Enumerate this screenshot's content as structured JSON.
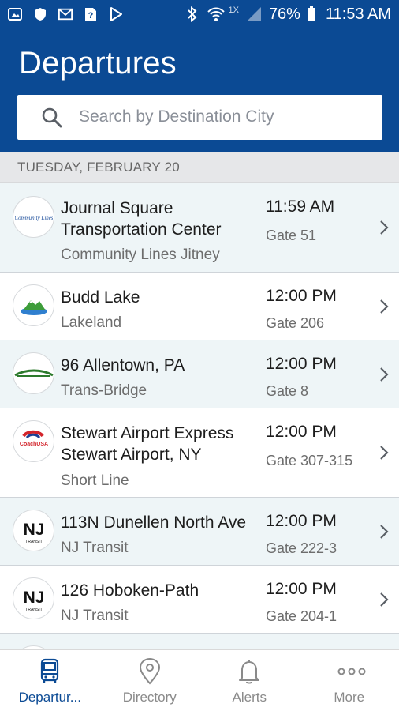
{
  "status_bar": {
    "icons": [
      "image-icon",
      "shield-icon",
      "mail-icon",
      "sim-help-icon",
      "play-store-icon"
    ],
    "right_icons": [
      "bluetooth-icon",
      "wifi-icon",
      "signal-icon",
      "battery-icon"
    ],
    "network_label": "1X",
    "battery": "76%",
    "time": "11:53 AM"
  },
  "header": {
    "title": "Departures",
    "search_placeholder": "Search by Destination City",
    "search_icon": "search-icon"
  },
  "date_label": "TUESDAY, FEBRUARY 20",
  "departures": [
    {
      "destination": "Journal Square Transportation Center",
      "carrier": "Community Lines Jitney",
      "time": "11:59 AM",
      "gate": "Gate 51",
      "logo": "community-lines-logo",
      "logo_text": "Community Lines"
    },
    {
      "destination": "Budd Lake",
      "carrier": "Lakeland",
      "time": "12:00 PM",
      "gate": "Gate 206",
      "logo": "lakeland-logo"
    },
    {
      "destination": "96 Allentown, PA",
      "carrier": "Trans-Bridge",
      "time": "12:00 PM",
      "gate": "Gate 8",
      "logo": "trans-bridge-logo"
    },
    {
      "destination": "Stewart Airport Express Stewart Airport, NY",
      "carrier": "Short Line",
      "time": "12:00 PM",
      "gate": "Gate 307-315",
      "logo": "coach-usa-logo",
      "logo_text": "CoachUSA"
    },
    {
      "destination": "113N Dunellen North Ave",
      "carrier": "NJ Transit",
      "time": "12:00 PM",
      "gate": "Gate 222-3",
      "logo": "nj-transit-logo",
      "logo_text": "NJ",
      "logo_subtext": "TRANSIT"
    },
    {
      "destination": "126 Hoboken-Path",
      "carrier": "NJ Transit",
      "time": "12:00 PM",
      "gate": "Gate 204-1",
      "logo": "nj-transit-logo",
      "logo_text": "NJ",
      "logo_subtext": "TRANSIT"
    }
  ],
  "bottom_nav": [
    {
      "label": "Departur...",
      "icon": "bus-icon",
      "active": true
    },
    {
      "label": "Directory",
      "icon": "location-pin-icon",
      "active": false
    },
    {
      "label": "Alerts",
      "icon": "bell-icon",
      "active": false
    },
    {
      "label": "More",
      "icon": "more-dots-icon",
      "active": false
    }
  ],
  "colors": {
    "brand_blue": "#0b4a94",
    "row_alt": "#eef5f7",
    "date_bar": "#e6e7e9"
  }
}
